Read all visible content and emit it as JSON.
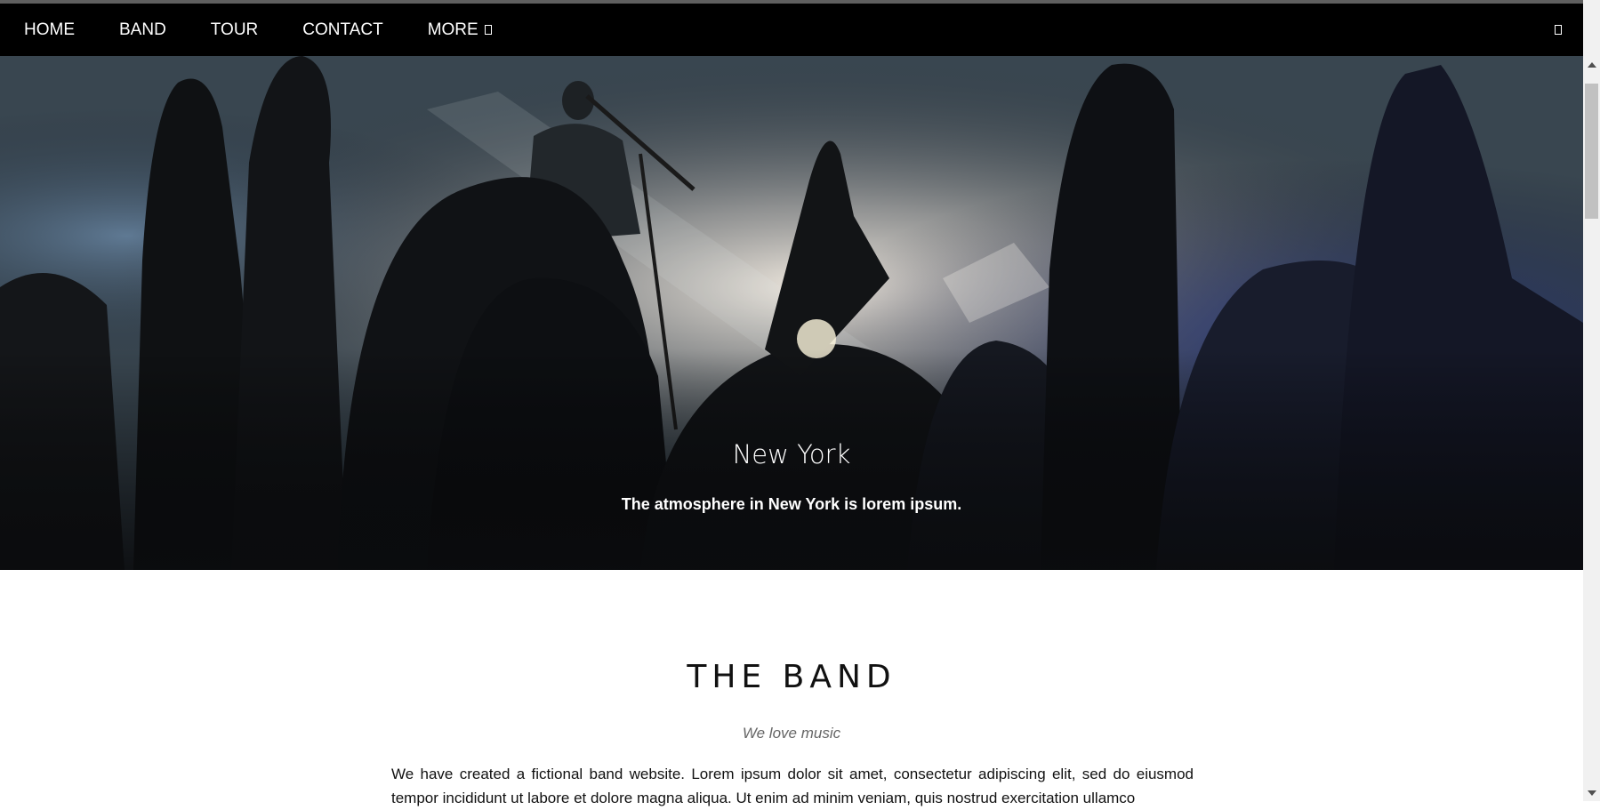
{
  "nav": {
    "items": [
      {
        "label": "HOME"
      },
      {
        "label": "BAND"
      },
      {
        "label": "TOUR"
      },
      {
        "label": "CONTACT"
      }
    ],
    "more_label": "MORE",
    "search_icon": "search-icon"
  },
  "hero": {
    "title": "New York",
    "caption": "The atmosphere in New York is lorem ipsum."
  },
  "band": {
    "title": "THE BAND",
    "subtitle": "We love music",
    "text": "We have created a fictional band website. Lorem ipsum dolor sit amet, consectetur adipiscing elit, sed do eiusmod tempor incididunt ut labore et dolore magna aliqua. Ut enim ad minim veniam, quis nostrud exercitation ullamco"
  },
  "colors": {
    "navbar_bg": "#000000",
    "nav_text": "#ffffff",
    "page_bg": "#ffffff"
  }
}
